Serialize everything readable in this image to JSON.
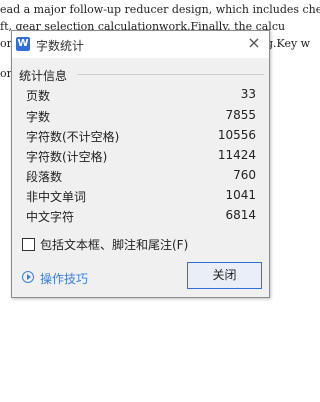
{
  "document": {
    "lines": [
      "ead a major follow-up reducer design, which includes che",
      "ft, gear selection calculationwork.Finally, the calcu",
      "or",
      "or"
    ],
    "right_fragment": "g.Key w"
  },
  "dialog": {
    "app_icon_glyph": "W",
    "title": "字数统计",
    "close_glyph": "×",
    "section_title": "统计信息",
    "stats": [
      {
        "label": "页数",
        "value": "33"
      },
      {
        "label": "字数",
        "value": "7855"
      },
      {
        "label": "字符数(不计空格)",
        "value": "10556"
      },
      {
        "label": "字符数(计空格)",
        "value": "11424"
      },
      {
        "label": "段落数",
        "value": "760"
      },
      {
        "label": "非中文单词",
        "value": "1041"
      },
      {
        "label": "中文字符",
        "value": "6814"
      }
    ],
    "checkbox_label": "包括文本框、脚注和尾注(F)",
    "tips_label": "操作技巧",
    "close_button_label": "关闭"
  },
  "colors": {
    "accent": "#2f6fd6",
    "link": "#3b7fd8",
    "dialog_bg": "#f0f0f0"
  },
  "icons": {
    "app": "wps-writer-icon",
    "close": "close-icon",
    "tips": "play-circle-icon"
  }
}
